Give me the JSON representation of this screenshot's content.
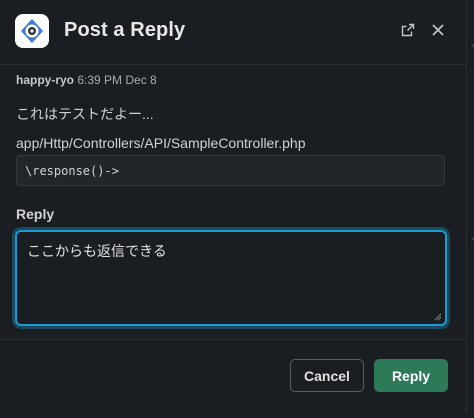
{
  "modal": {
    "title": "Post a Reply"
  },
  "message": {
    "author": "happy-ryo",
    "timestamp": "6:39 PM Dec 8",
    "text": "これはテストだよー...",
    "file_path": "app/Http/Controllers/API/SampleController.php",
    "code": "\\response()->"
  },
  "reply": {
    "label": "Reply",
    "value": "ここからも返信できる"
  },
  "buttons": {
    "cancel": "Cancel",
    "reply": "Reply"
  },
  "icons": {
    "logo": "app-logo-icon",
    "open_external": "external-link-icon",
    "close": "close-icon"
  },
  "colors": {
    "background": "#1a1d21",
    "focus_border": "#1d9bd1",
    "primary_button": "#2c7a58"
  }
}
